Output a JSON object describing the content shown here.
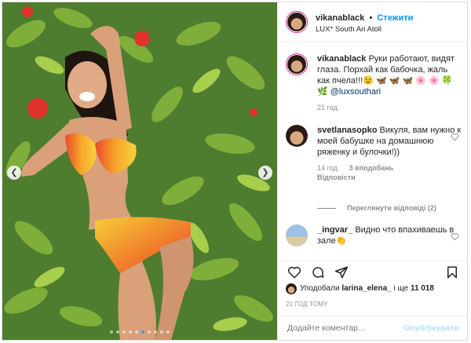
{
  "post": {
    "username": "vikanablack",
    "follow_label": "Стежити",
    "separator": "•",
    "location": "LUX* South Ari Atoll"
  },
  "caption": {
    "username": "vikanablack",
    "text": "Руки работают, видят глаза. Порхай как бабочка, жаль как пчела!!!😉 🦋 🦋 🦋 🌸 🌸 🍀 🌿",
    "mention": "@luxsouthari",
    "time": "21 год."
  },
  "comments": [
    {
      "username": "svetlanasopko",
      "text": "Викуля, вам нужно к моей бабушке на домашнюю ряженку и булочки!))",
      "time": "14 год.",
      "likes": "3 вподобань",
      "reply_label": "Відповісти",
      "view_replies": "Переглянути відповіді (2)"
    },
    {
      "username": "_ingvar_",
      "text": "Видно что впахиваешь в зале👏"
    }
  ],
  "likes": {
    "prefix": "Уподобали",
    "user": "larina_elena_",
    "middle": "і ще",
    "count": "11 018"
  },
  "timestamp": "21 ГОД ТОМУ",
  "add_comment": {
    "placeholder": "Додайте коментар...",
    "post_label": "Опублікувати"
  },
  "colors": {
    "accent": "#0095f6",
    "post_disabled": "#b2dffc",
    "muted": "#8e8e8e"
  },
  "icons": [
    "heart-icon",
    "comment-icon",
    "share-icon",
    "bookmark-icon",
    "chevron-left-icon",
    "chevron-right-icon"
  ]
}
